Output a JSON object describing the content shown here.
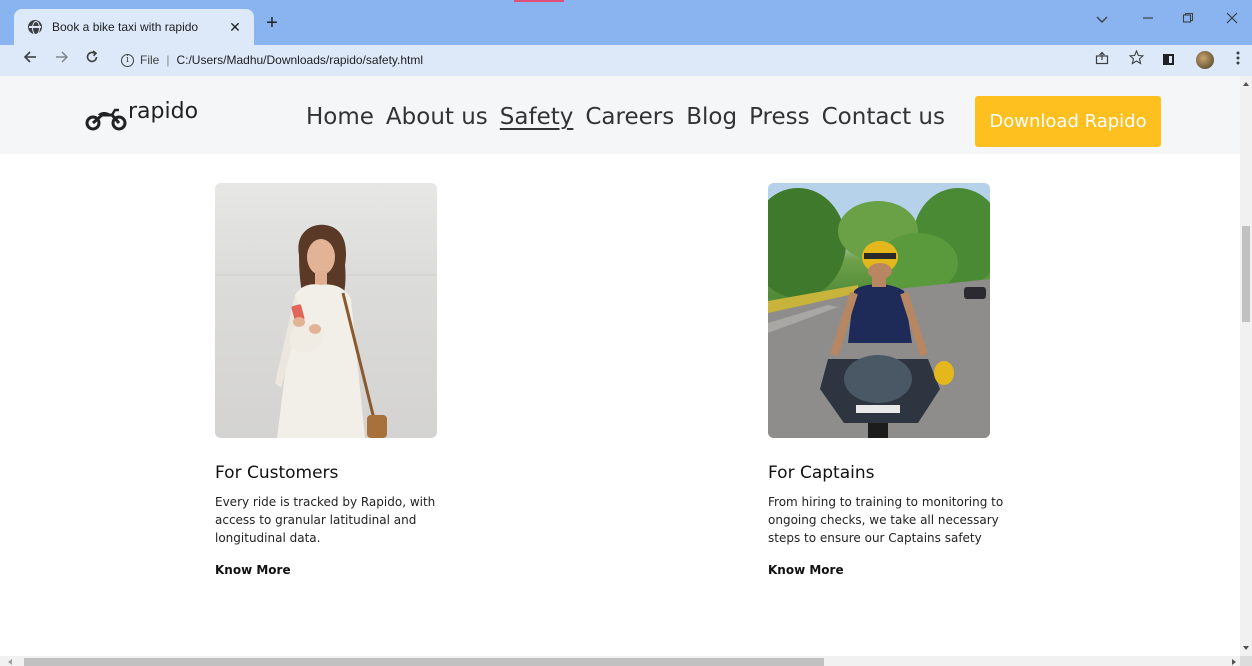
{
  "browser": {
    "tab_title": "Book a bike taxi with rapido",
    "tab_close": "✕",
    "new_tab": "+",
    "scheme": "File",
    "separator": "|",
    "url": "C:/Users/Madhu/Downloads/rapido/safety.html",
    "info_glyph": "i",
    "icons": {
      "back": "arrow-left-icon",
      "forward": "arrow-right-icon",
      "reload": "reload-icon",
      "share": "share-icon",
      "bookmark": "star-icon",
      "side_panel": "side-panel-icon",
      "profile": "avatar",
      "menu": "kebab-menu-icon"
    },
    "colors": {
      "tab_strip": "#8ab4f0",
      "toolbar": "#dde8f8"
    }
  },
  "header": {
    "logo_text": "rapido",
    "nav": [
      {
        "label": "Home",
        "active": false
      },
      {
        "label": "About us",
        "active": false
      },
      {
        "label": "Safety",
        "active": true
      },
      {
        "label": "Careers",
        "active": false
      },
      {
        "label": "Blog",
        "active": false
      },
      {
        "label": "Press",
        "active": false
      },
      {
        "label": "Contact us",
        "active": false
      }
    ],
    "download_label": "Download Rapido",
    "colors": {
      "download_bg": "#fdc01f",
      "header_bg": "#f5f6f7"
    }
  },
  "cards": [
    {
      "title": "For Customers",
      "text": "Every ride is tracked by Rapido, with access to granular latitudinal and longitudinal data.",
      "link": "Know More",
      "image_desc": "woman-using-phone-photo"
    },
    {
      "title": "For Captains",
      "text": "From hiring to training to monitoring to ongoing checks, we take all necessary steps to ensure our Captains safety",
      "link": "Know More",
      "image_desc": "captain-on-motorbike-photo"
    }
  ]
}
